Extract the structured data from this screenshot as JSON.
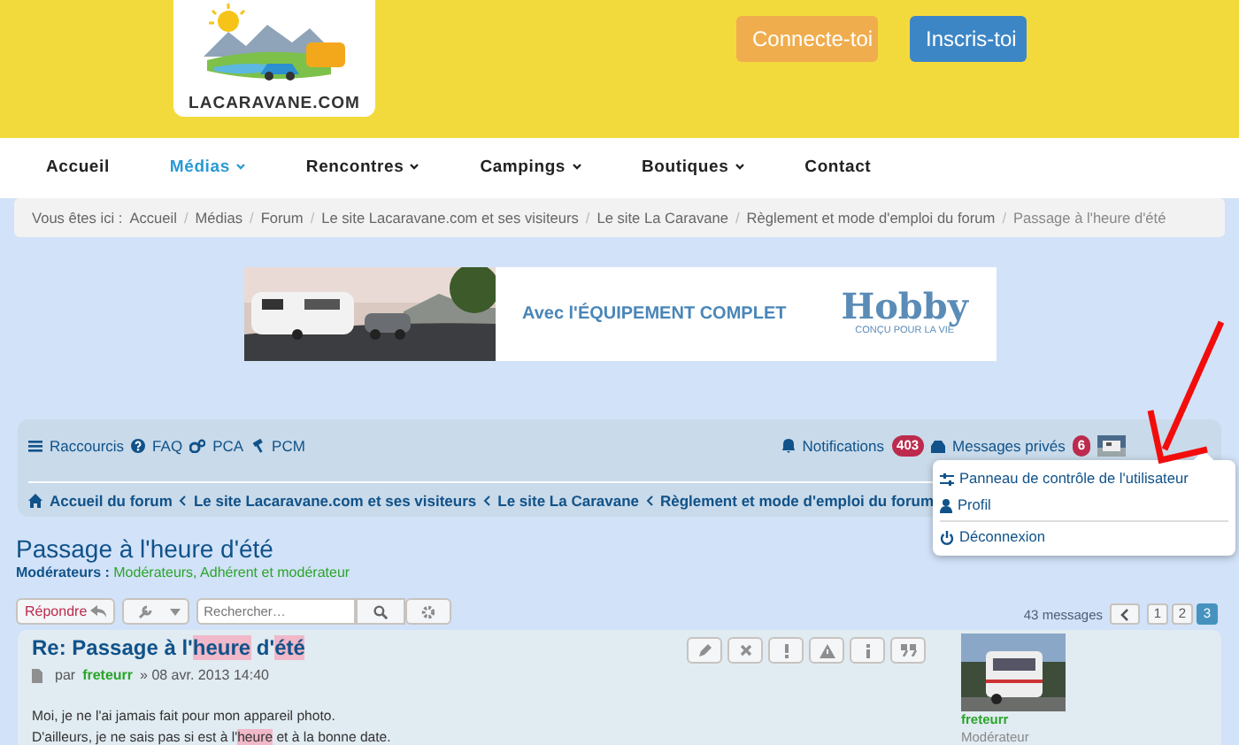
{
  "header": {
    "logo_text": "LACARAVANE.COM",
    "buttons": [
      {
        "label": "Connecte-toi",
        "kind": "login"
      },
      {
        "label": "Inscris-toi",
        "kind": "register"
      }
    ]
  },
  "nav": [
    {
      "label": "Accueil",
      "selected": false,
      "dropdown": false
    },
    {
      "label": "Médias",
      "selected": true,
      "dropdown": true
    },
    {
      "label": "Rencontres",
      "selected": false,
      "dropdown": true
    },
    {
      "label": "Campings",
      "selected": false,
      "dropdown": true
    },
    {
      "label": "Boutiques",
      "selected": false,
      "dropdown": true
    },
    {
      "label": "Contact",
      "selected": false,
      "dropdown": false
    }
  ],
  "breadcrumb": {
    "prefix": "Vous êtes ici :",
    "separator": "/",
    "items": [
      "Accueil",
      "Médias",
      "Forum",
      "Le site Lacaravane.com et ses visiteurs",
      "Le site La Caravane",
      "Règlement et mode d'emploi du forum",
      "Passage à l'heure d'été"
    ]
  },
  "banner": {
    "kind": "picture",
    "slogan": "Avec l'ÉQUIPEMENT COMPLET",
    "brand": "Hobby",
    "tagline": "CONÇU POUR LA VIE"
  },
  "forum_bar": {
    "links": [
      {
        "label": "Raccourcis"
      },
      {
        "label": "FAQ"
      },
      {
        "label": "PCA"
      },
      {
        "label": "PCM"
      }
    ],
    "notifications": {
      "label": "Notifications",
      "count": "403"
    },
    "messages": {
      "label": "Messages privés",
      "count": "6"
    },
    "crumbs": [
      "Accueil du forum",
      "Le site Lacaravane.com et ses visiteurs",
      "Le site La Caravane",
      "Règlement et mode d'emploi du forum"
    ]
  },
  "user_menu": [
    {
      "label": "Panneau de contrôle de l'utilisateur"
    },
    {
      "label": "Profil"
    },
    {
      "label": "Déconnexion"
    }
  ],
  "topic": {
    "title": "Passage à l'heure d'été",
    "moderators_label": "Modérateurs :",
    "moderators": "Modérateurs, Adhérent et modérateur"
  },
  "toolbar": {
    "reply": "Répondre",
    "search_placeholder": "Rechercher…",
    "count": "43 messages",
    "pages": [
      {
        "label": "1",
        "selected": false
      },
      {
        "label": "2",
        "selected": false
      },
      {
        "label": "3",
        "selected": true
      }
    ]
  },
  "post": {
    "title": [
      {
        "text": "Re: Passage à l'",
        "highlight": false
      },
      {
        "text": "heure",
        "highlight": true
      },
      {
        "text": " d'",
        "highlight": false
      },
      {
        "text": "été",
        "highlight": true
      }
    ],
    "by": "par",
    "author": "freteurr",
    "date": "» 08 avr. 2013 14:40",
    "lines": [
      [
        {
          "text": "Moi, je ne l'ai jamais fait pour mon appareil photo.",
          "highlight": false
        }
      ],
      [
        {
          "text": "D'ailleurs, je ne sais pas si est à l'",
          "highlight": false
        },
        {
          "text": "heure",
          "highlight": true
        },
        {
          "text": " et à la bonne date.",
          "highlight": false
        }
      ]
    ],
    "profile_name": "freteurr",
    "profile_rank": "Modérateur"
  }
}
